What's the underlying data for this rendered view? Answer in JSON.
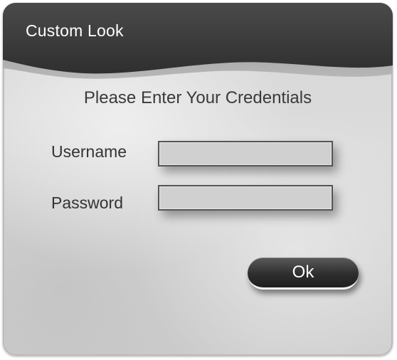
{
  "window": {
    "title": "Custom Look"
  },
  "form": {
    "prompt": "Please Enter Your Credentials",
    "username_label": "Username",
    "username_value": "",
    "password_label": "Password",
    "password_value": "",
    "ok_label": "Ok"
  },
  "colors": {
    "header": "#3a3a3a",
    "background": "#d6d6d6",
    "button": "#2e2e2e"
  }
}
